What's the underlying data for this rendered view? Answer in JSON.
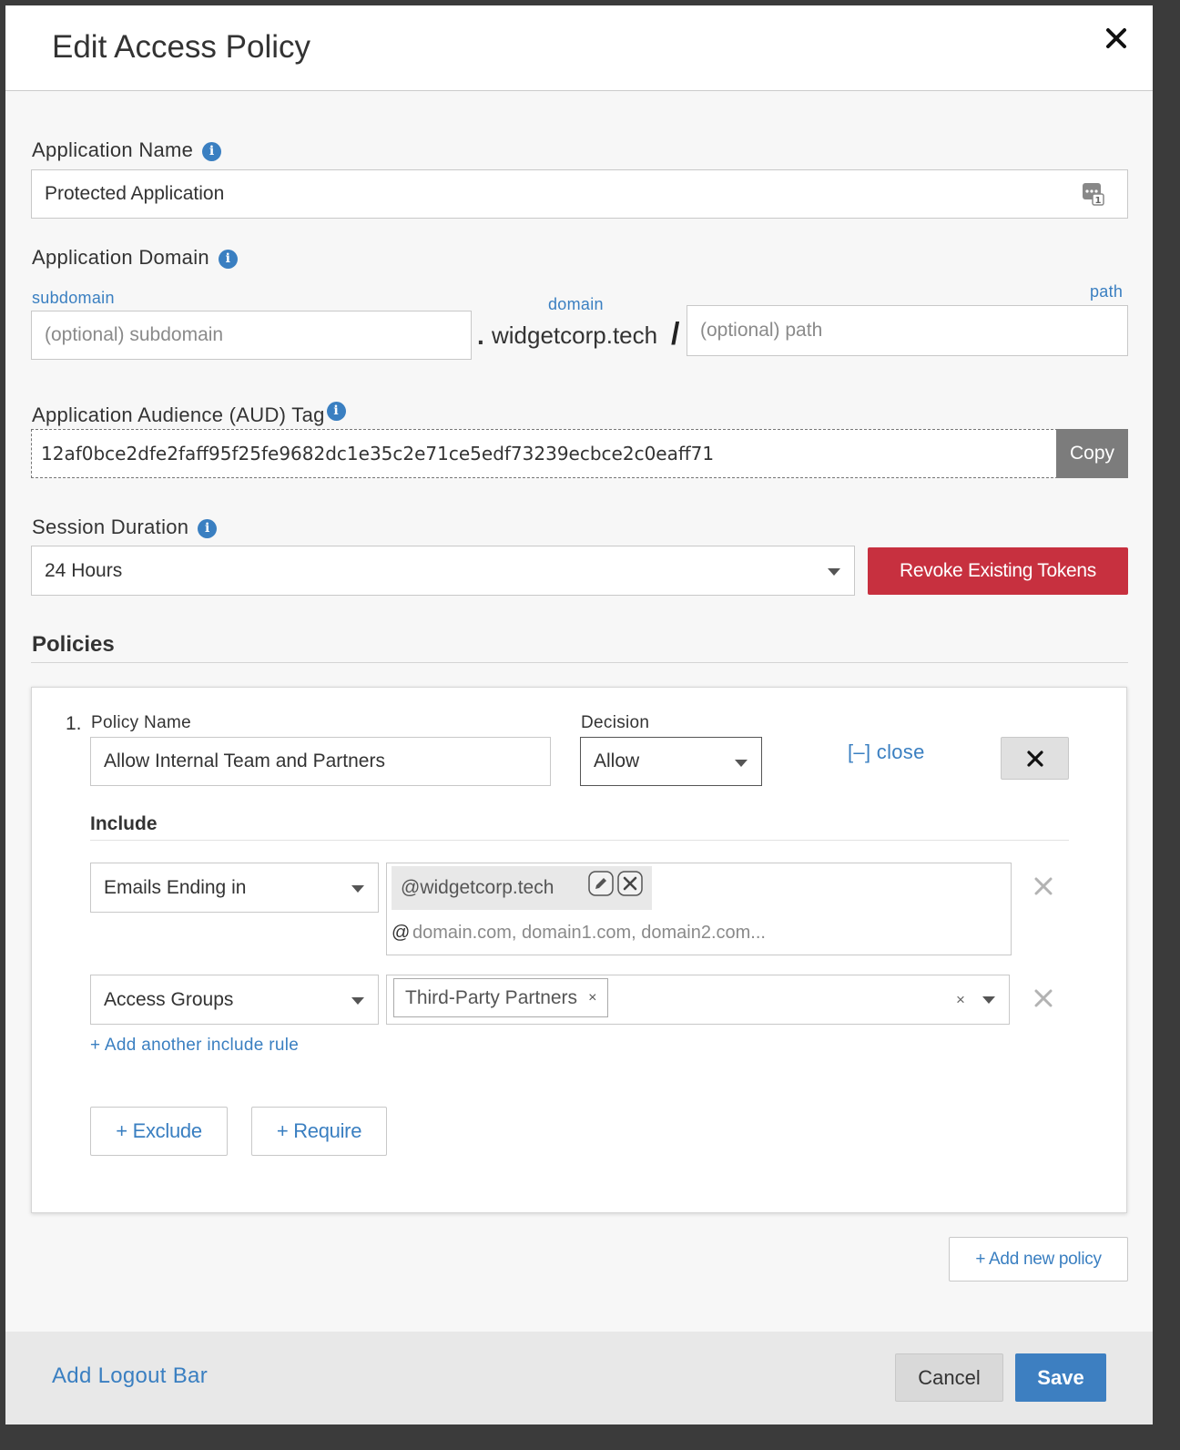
{
  "modal": {
    "title": "Edit Access Policy",
    "close_icon": "close-icon"
  },
  "app_name": {
    "label": "Application Name",
    "value": "Protected Application"
  },
  "app_domain": {
    "label": "Application Domain",
    "subdomain_label": "subdomain",
    "subdomain_placeholder": "(optional) subdomain",
    "domain_label": "domain",
    "dot": ".",
    "domain_value": "widgetcorp.tech",
    "slash": "/",
    "path_label": "path",
    "path_placeholder": "(optional) path"
  },
  "aud": {
    "label": "Application Audience (AUD) Tag",
    "value": "12af0bce2dfe2faff95f25fe9682dc1e35c2e71ce5edf73239ecbce2c0eaff71",
    "copy_label": "Copy"
  },
  "session": {
    "label": "Session Duration",
    "value": "24 Hours",
    "revoke_label": "Revoke Existing Tokens"
  },
  "policies": {
    "title": "Policies",
    "items": [
      {
        "number": "1.",
        "name_label": "Policy Name",
        "name_value": "Allow Internal Team and Partners",
        "decision_label": "Decision",
        "decision_value": "Allow",
        "close_link": "[–] close",
        "include_title": "Include",
        "rules": [
          {
            "type": "Emails Ending in",
            "tag": "@widgetcorp.tech",
            "prefix": "@",
            "placeholder": "domain.com, domain1.com, domain2.com..."
          },
          {
            "type": "Access Groups",
            "tag": "Third-Party Partners",
            "tag_remove": "×",
            "clear": "×"
          }
        ],
        "add_include": "+ Add another include rule",
        "exclude_label": "+ Exclude",
        "require_label": "+ Require"
      }
    ],
    "add_policy": "+ Add new policy"
  },
  "footer": {
    "logout_bar": "Add Logout Bar",
    "cancel": "Cancel",
    "save": "Save"
  },
  "colors": {
    "accent": "#3a7fc1",
    "danger": "#c7303f",
    "save": "#3d7fc1"
  }
}
